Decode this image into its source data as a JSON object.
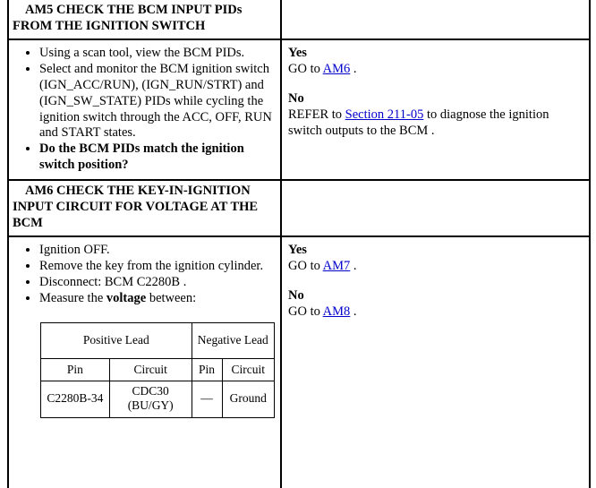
{
  "document": {
    "type": "pinpoint-test",
    "link_color": "#0000cc",
    "border_color": "#000000",
    "background": "#ffffff"
  },
  "tests": [
    {
      "id": "AM5",
      "title": "AM5 CHECK THE BCM INPUT PIDs FROM THE IGNITION SWITCH",
      "steps": [
        {
          "text": "Using a scan tool, view the BCM PIDs.",
          "bold": false
        },
        {
          "text": "Select and monitor the BCM ignition switch (IGN_ACC/RUN), (IGN_RUN/STRT) and (IGN_SW_STATE) PIDs while cycling the ignition switch through the ACC, OFF, RUN and START states.",
          "bold": false
        },
        {
          "text": "Do the BCM PIDs match the ignition switch position?",
          "bold": true
        }
      ],
      "answers": [
        {
          "label": "Yes",
          "prefix": "GO to ",
          "link": "AM6",
          "suffix": " ."
        },
        {
          "label": "No",
          "prefix": "REFER to ",
          "link": "Section 211-05",
          "suffix": " to diagnose the ignition switch outputs to the BCM ."
        }
      ]
    },
    {
      "id": "AM6",
      "title": "AM6 CHECK THE KEY-IN-IGNITION INPUT CIRCUIT FOR VOLTAGE AT THE BCM",
      "steps": [
        {
          "text": "Ignition OFF.",
          "bold": false
        },
        {
          "text": "Remove the key from the ignition cylinder.",
          "bold": false
        },
        {
          "text": "Disconnect: BCM C2280B .",
          "bold": false
        },
        {
          "text": "Measure the voltage between:",
          "bold": false,
          "bold_word": "voltage"
        }
      ],
      "lead_table": {
        "group_headers": [
          "Positive Lead",
          "Negative Lead"
        ],
        "column_headers": [
          "Pin",
          "Circuit",
          "Pin",
          "Circuit"
        ],
        "rows": [
          [
            "C2280B-34",
            "CDC30 (BU/GY)",
            "—",
            "Ground"
          ]
        ]
      },
      "answers": [
        {
          "label": "Yes",
          "prefix": "GO to ",
          "link": "AM7",
          "suffix": " ."
        },
        {
          "label": "No",
          "prefix": "GO to ",
          "link": "AM8",
          "suffix": " ."
        }
      ]
    }
  ]
}
